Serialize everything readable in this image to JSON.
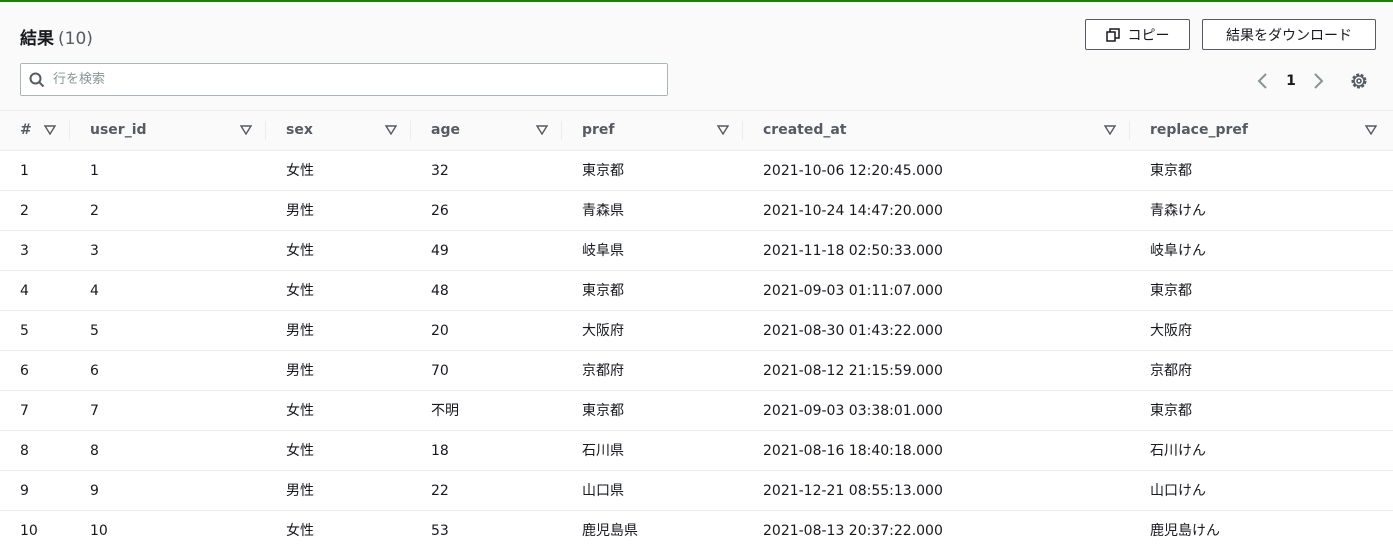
{
  "header": {
    "title": "結果",
    "count": "(10)",
    "copy_label": "コピー",
    "download_label": "結果をダウンロード"
  },
  "search": {
    "placeholder": "行を検索",
    "value": ""
  },
  "pagination": {
    "current_page": "1"
  },
  "colors": {
    "accent_top": "#1d8102",
    "border": "#eaeded",
    "header_bg": "#fafafa"
  },
  "table": {
    "columns": [
      "#",
      "user_id",
      "sex",
      "age",
      "pref",
      "created_at",
      "replace_pref"
    ],
    "rows": [
      [
        "1",
        "1",
        "女性",
        "32",
        "東京都",
        "2021-10-06 12:20:45.000",
        "東京都"
      ],
      [
        "2",
        "2",
        "男性",
        "26",
        "青森県",
        "2021-10-24 14:47:20.000",
        "青森けん"
      ],
      [
        "3",
        "3",
        "女性",
        "49",
        "岐阜県",
        "2021-11-18 02:50:33.000",
        "岐阜けん"
      ],
      [
        "4",
        "4",
        "女性",
        "48",
        "東京都",
        "2021-09-03 01:11:07.000",
        "東京都"
      ],
      [
        "5",
        "5",
        "男性",
        "20",
        "大阪府",
        "2021-08-30 01:43:22.000",
        "大阪府"
      ],
      [
        "6",
        "6",
        "男性",
        "70",
        "京都府",
        "2021-08-12 21:15:59.000",
        "京都府"
      ],
      [
        "7",
        "7",
        "女性",
        "不明",
        "東京都",
        "2021-09-03 03:38:01.000",
        "東京都"
      ],
      [
        "8",
        "8",
        "女性",
        "18",
        "石川県",
        "2021-08-16 18:40:18.000",
        "石川けん"
      ],
      [
        "9",
        "9",
        "男性",
        "22",
        "山口県",
        "2021-12-21 08:55:13.000",
        "山口けん"
      ],
      [
        "10",
        "10",
        "女性",
        "53",
        "鹿児島県",
        "2021-08-13 20:37:22.000",
        "鹿児島けん"
      ]
    ]
  }
}
